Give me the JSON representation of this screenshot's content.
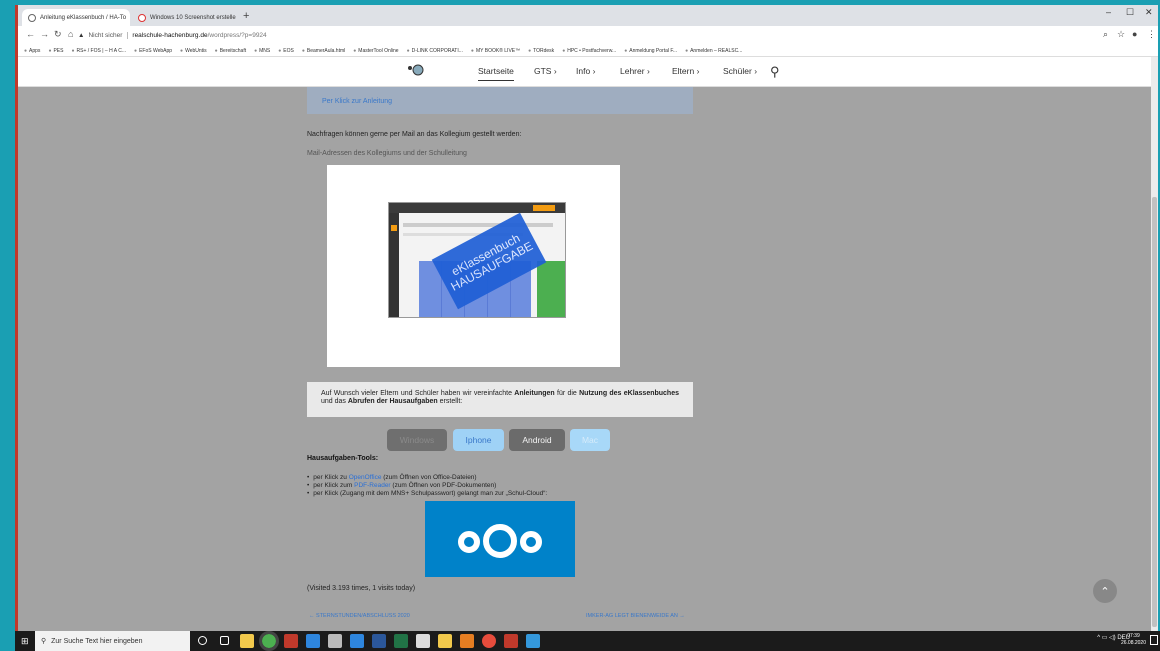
{
  "browser": {
    "tabs": [
      {
        "label": "Anleitung eKlassenbuch / HA-To"
      },
      {
        "label": "Windows 10 Screenshot erstelle"
      }
    ],
    "url_warning": "Nicht sicher",
    "url_domain": "realschule-hachenburg.de",
    "url_path": "/wordpress/?p=9924",
    "bookmarks": [
      "Apps",
      "PES",
      "RS+ / FOS | – H A C...",
      "EFoS WebApp",
      "WebUntis",
      "Bereitschaft",
      "MNS",
      "EOS",
      "BeamerAula.html",
      "MasterTool Online",
      "D-LINK CORPORATI...",
      "MY BOOK® LIVE™",
      "TORdesk",
      "HPC • Postfachverw...",
      "Anmeldung Portal F...",
      "Anmelden – REALSC..."
    ]
  },
  "site_nav": {
    "items": [
      {
        "label": "Startseite"
      },
      {
        "label": "GTS"
      },
      {
        "label": "Info"
      },
      {
        "label": "Lehrer"
      },
      {
        "label": "Eltern"
      },
      {
        "label": "Schüler"
      }
    ],
    "chevron": "›"
  },
  "content": {
    "infobox_link": "Per Klick zur Anleitung",
    "mail_text": "Nachfragen können gerne per Mail an das Kollegium gestellt werden:",
    "mail_link": "Mail-Adressen des Kollegiums und der Schulleitung",
    "stamp_line1": "eKlassenbuch",
    "stamp_line2": "HAUSAUFGABE",
    "greybox_text_1": "Auf Wunsch vieler Eltern und Schüler haben wir vereinfachte ",
    "greybox_bold_1": "Anleitungen",
    "greybox_text_2": " für die ",
    "greybox_bold_2": "Nutzung des eKlassenbuches",
    "greybox_text_3": " und das ",
    "greybox_bold_3": "Abrufen der Hausaufgaben",
    "greybox_text_4": " erstellt:",
    "buttons": [
      {
        "label": "Windows"
      },
      {
        "label": "Iphone"
      },
      {
        "label": "Android"
      },
      {
        "label": "Mac"
      }
    ],
    "tools_heading": "Hausaufgaben-Tools:",
    "tools": [
      {
        "pre": "per Klick zu ",
        "link": "OpenOffice",
        "post": " (zum Öffnen von Office-Dateien)"
      },
      {
        "pre": "per Klick zum ",
        "link": "PDF-Reader",
        "post": " (zum Öffnen von PDF-Dokumenten)"
      },
      {
        "pre": "per Klick (Zugang mit dem MNS+ Schulpasswort) gelangt man zur „Schul-Cloud“:",
        "link": "",
        "post": ""
      }
    ],
    "visited": "(Visited 3.193 times, 1 visits today)",
    "prev_post": "← STERNSTUNDEN/ABSCHLUSS 2020",
    "next_post": "IMKER-AG LEGT BIENENWEIDE AN →"
  },
  "taskbar": {
    "search_placeholder": "Zur Suche Text hier eingeben",
    "tray_lang": "DEU",
    "time": "07:39",
    "date": "26.08.2020"
  },
  "colors": {
    "accent_blue": "#3a78c9",
    "cloud_blue": "#0082c9",
    "desktop_teal": "#1a9fb3"
  }
}
